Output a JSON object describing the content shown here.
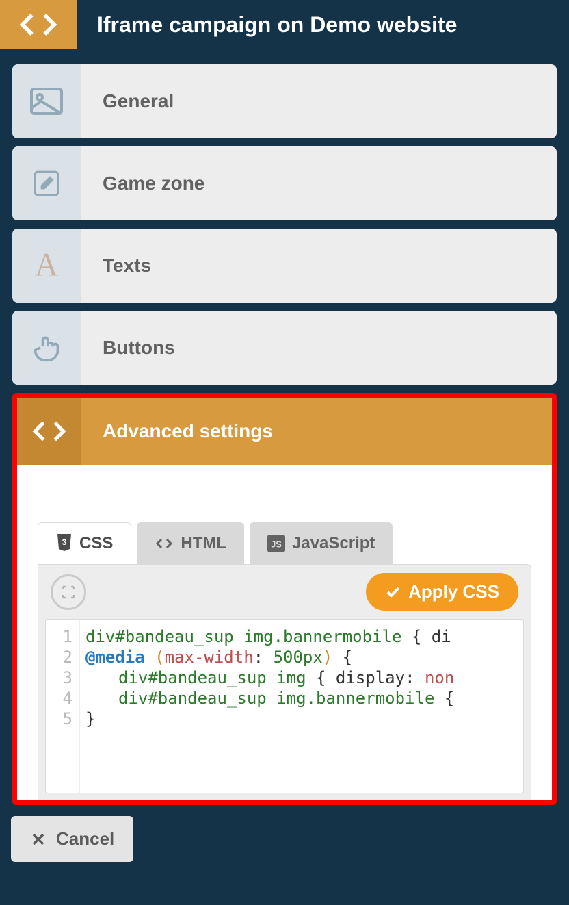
{
  "header": {
    "title": "Iframe campaign on Demo website"
  },
  "accordion": [
    {
      "id": "general",
      "label": "General",
      "icon": "image-icon"
    },
    {
      "id": "gamezone",
      "label": "Game zone",
      "icon": "pencil-icon"
    },
    {
      "id": "texts",
      "label": "Texts",
      "icon": "letter-a-icon"
    },
    {
      "id": "buttons",
      "label": "Buttons",
      "icon": "pointer-icon"
    }
  ],
  "advanced": {
    "label": "Advanced settings",
    "tabs": [
      {
        "id": "css",
        "label": "CSS",
        "icon": "css3-icon",
        "active": true
      },
      {
        "id": "html",
        "label": "HTML",
        "icon": "code-icon",
        "active": false
      },
      {
        "id": "javascript",
        "label": "JavaScript",
        "icon": "js-icon",
        "active": false
      }
    ],
    "apply_label": "Apply CSS",
    "code": {
      "line_numbers": [
        "1",
        "2",
        "3",
        "4",
        "5"
      ],
      "lines": [
        {
          "tokens": [
            {
              "t": "div",
              "c": "tok-tag"
            },
            {
              "t": "#bandeau_sup",
              "c": "tok-sel"
            },
            {
              "t": " ",
              "c": ""
            },
            {
              "t": "img",
              "c": "tok-tag"
            },
            {
              "t": ".bannermobile",
              "c": "tok-sel"
            },
            {
              "t": " { ",
              "c": "tok-brace"
            },
            {
              "t": "di",
              "c": "tok-prop"
            }
          ]
        },
        {
          "tokens": [
            {
              "t": "@media",
              "c": "tok-at"
            },
            {
              "t": " ",
              "c": ""
            },
            {
              "t": "(",
              "c": "tok-paren"
            },
            {
              "t": "max-width",
              "c": "tok-prop2"
            },
            {
              "t": ": ",
              "c": "tok-brace"
            },
            {
              "t": "500px",
              "c": "tok-num"
            },
            {
              "t": ")",
              "c": "tok-paren"
            },
            {
              "t": " {",
              "c": "tok-brace"
            }
          ]
        },
        {
          "indent": true,
          "tokens": [
            {
              "t": "div",
              "c": "tok-tag"
            },
            {
              "t": "#bandeau_sup",
              "c": "tok-sel"
            },
            {
              "t": " ",
              "c": ""
            },
            {
              "t": "img",
              "c": "tok-tag"
            },
            {
              "t": " { ",
              "c": "tok-brace"
            },
            {
              "t": "display",
              "c": "tok-prop"
            },
            {
              "t": ": ",
              "c": "tok-brace"
            },
            {
              "t": "non",
              "c": "tok-prop2"
            }
          ]
        },
        {
          "indent": true,
          "tokens": [
            {
              "t": "div",
              "c": "tok-tag"
            },
            {
              "t": "#bandeau_sup",
              "c": "tok-sel"
            },
            {
              "t": " ",
              "c": ""
            },
            {
              "t": "img",
              "c": "tok-tag"
            },
            {
              "t": ".bannermobile",
              "c": "tok-sel"
            },
            {
              "t": " {",
              "c": "tok-brace"
            }
          ]
        },
        {
          "tokens": [
            {
              "t": "}",
              "c": "tok-brace"
            }
          ]
        }
      ]
    }
  },
  "footer": {
    "cancel_label": "Cancel"
  }
}
